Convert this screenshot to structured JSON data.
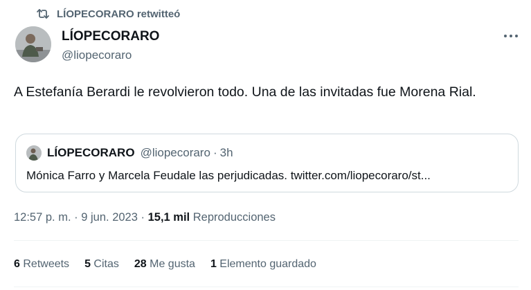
{
  "retweet_context": {
    "icon": "retweet-icon",
    "text": "LÍOPECORARO retwitteó"
  },
  "author": {
    "name": "LÍOPECORARO",
    "handle": "@liopecoraro"
  },
  "more_icon": "more-dots-icon",
  "tweet": {
    "text": "A Estefanía Berardi le revolvieron todo. Una de las invitadas fue Morena Rial."
  },
  "quoted_tweet": {
    "name": "LÍOPECORARO",
    "handle": "@liopecoraro",
    "separator": "·",
    "time": "3h",
    "text": "Mónica Farro y Marcela Feudale las perjudicadas. twitter.com/liopecoraro/st..."
  },
  "meta": {
    "time": "12:57 p. m.",
    "separator": "·",
    "date": "9 jun. 2023",
    "views_count": "15,1 mil",
    "views_label": "Reproducciones"
  },
  "stats": [
    {
      "count": "6",
      "label": "Retweets"
    },
    {
      "count": "5",
      "label": "Citas"
    },
    {
      "count": "28",
      "label": "Me gusta"
    },
    {
      "count": "1",
      "label": "Elemento guardado"
    }
  ],
  "colors": {
    "primary_text": "#0f1419",
    "secondary_text": "#536471",
    "border": "#cfd9de",
    "divider": "#eff3f4"
  }
}
